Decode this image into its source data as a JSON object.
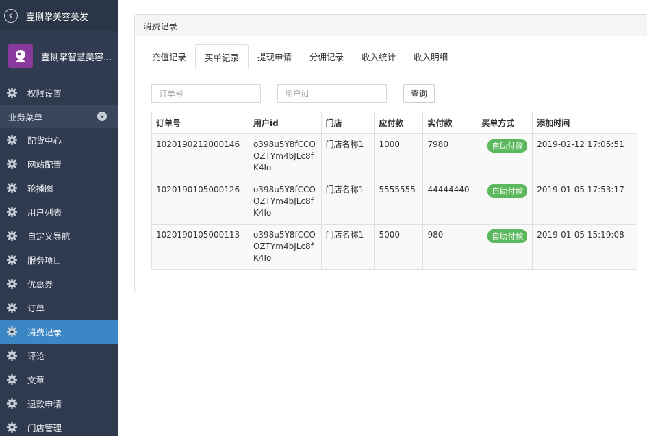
{
  "sidebar": {
    "app_title": "壹捌掌美容美发",
    "username": "壹捌掌智慧美容...",
    "top_items": [
      {
        "label": "权限设置"
      }
    ],
    "group_label": "业务菜单",
    "items": [
      {
        "label": "配货中心"
      },
      {
        "label": "网站配置"
      },
      {
        "label": "轮播图"
      },
      {
        "label": "用户列表"
      },
      {
        "label": "自定义导航"
      },
      {
        "label": "服务项目"
      },
      {
        "label": "优惠券"
      },
      {
        "label": "订单"
      },
      {
        "label": "消费记录",
        "active": true
      },
      {
        "label": "评论"
      },
      {
        "label": "文章"
      },
      {
        "label": "退款申请"
      },
      {
        "label": "门店管理"
      }
    ]
  },
  "panel": {
    "title": "消费记录",
    "tabs": [
      {
        "label": "充值记录"
      },
      {
        "label": "买单记录",
        "active": true
      },
      {
        "label": "提现申请"
      },
      {
        "label": "分佣记录"
      },
      {
        "label": "收入统计"
      },
      {
        "label": "收入明细"
      }
    ],
    "filters": {
      "order_placeholder": "订单号",
      "user_placeholder": "用户id",
      "query_label": "查询"
    },
    "table": {
      "headers": [
        "订单号",
        "用户id",
        "门店",
        "应付款",
        "实付款",
        "买单方式",
        "添加时间"
      ],
      "rows": [
        {
          "order": "1020190212000146",
          "user_id": "o398u5Y8fCCOOZTYm4bJLc8fK4Io",
          "store": "门店名称1",
          "payable": "1000",
          "paid": "7980",
          "method": "自助付款",
          "time": "2019-02-12 17:05:51"
        },
        {
          "order": "1020190105000126",
          "user_id": "o398u5Y8fCCOOZTYm4bJLc8fK4Io",
          "store": "门店名称1",
          "payable": "5555555",
          "paid": "44444440",
          "method": "自助付款",
          "time": "2019-01-05 17:53:17"
        },
        {
          "order": "1020190105000113",
          "user_id": "o398u5Y8fCCOOZTYm4bJLc8fK4Io",
          "store": "门店名称1",
          "payable": "5000",
          "paid": "980",
          "method": "自助付款",
          "time": "2019-01-05 15:19:08"
        }
      ]
    }
  },
  "colors": {
    "sidebar_bg": "#2f3a4f",
    "active_bg": "#3d86c6",
    "badge_green": "#5cb85c"
  }
}
